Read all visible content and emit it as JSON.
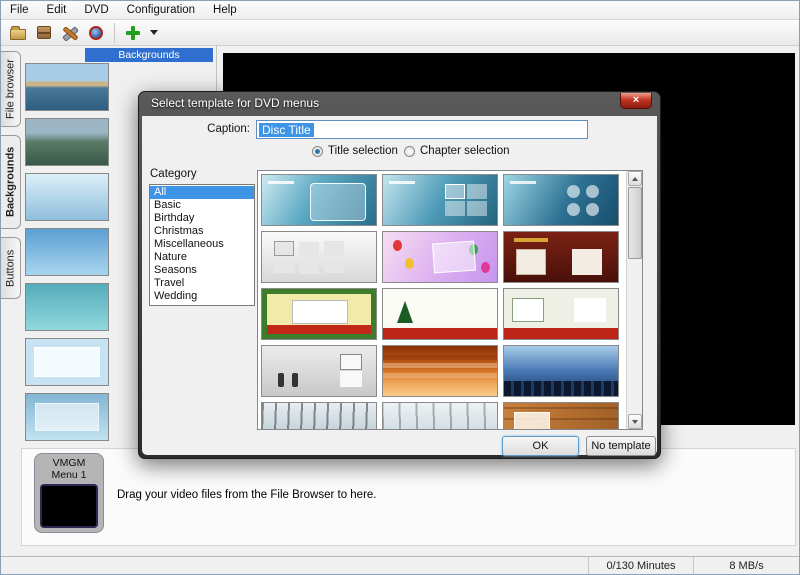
{
  "app": {
    "menu": [
      "File",
      "Edit",
      "DVD",
      "Configuration",
      "Help"
    ],
    "toolbar_icons": [
      "open-folder",
      "project-box",
      "tools",
      "burn-disc",
      "add-menu",
      "add-menu-dropdown"
    ],
    "sidebar_tabs": [
      "File browser",
      "Backgrounds",
      "Buttons"
    ],
    "backgrounds_panel_title": "Backgrounds",
    "backgrounds_thumbs": [
      "coastline-photo",
      "lake-photo",
      "sky-gradient",
      "blue-gradient",
      "teal-gradient",
      "blue-frame",
      "blue-soft"
    ],
    "vmgm_label": "VMGM",
    "menu1_label": "Menu 1",
    "drag_hint": "Drag your video files from the File Browser to here.",
    "status_minutes": "0/130 Minutes",
    "status_speed": "8 MB/s"
  },
  "dialog": {
    "title": "Select template for DVD menus",
    "close_glyph": "×",
    "caption_label": "Caption:",
    "caption_value": "Disc Title",
    "radio_title_label": "Title selection",
    "radio_chapter_label": "Chapter selection",
    "radio_selected": "Title selection",
    "category_label": "Category",
    "categories": [
      "All",
      "Basic",
      "Birthday",
      "Christmas",
      "Miscellaneous",
      "Nature",
      "Seasons",
      "Travel",
      "Wedding"
    ],
    "selected_category": "All",
    "ok_label": "OK",
    "no_template_label": "No template"
  },
  "colors": {
    "selection_blue": "#3f95e5",
    "panel_header_blue": "#2f6fd0",
    "dialog_frame": "#2c2c2c",
    "close_button_red": "#c23524",
    "add_icon_green": "#1fa11f"
  },
  "templates": {
    "rows": 5,
    "cols": 3,
    "items": [
      {
        "name": "blue-glass-panel",
        "colors": [
          "#cdeaf2",
          "#28708e"
        ]
      },
      {
        "name": "blue-glass-grid",
        "colors": [
          "#c4e4ee",
          "#236480"
        ]
      },
      {
        "name": "blue-circles",
        "colors": [
          "#9ed6e4",
          "#184e6e"
        ]
      },
      {
        "name": "gray-frames",
        "colors": [
          "#fafafa",
          "#d8d8d8"
        ]
      },
      {
        "name": "birthday-balloons",
        "colors": [
          "#f6def2",
          "#c695ee"
        ]
      },
      {
        "name": "dark-red-frames",
        "colors": [
          "#7c2214",
          "#49100a"
        ]
      },
      {
        "name": "christmas-border",
        "colors": [
          "#f2eaa8",
          "#c22818"
        ]
      },
      {
        "name": "christmas-trees",
        "colors": [
          "#fbfbf6",
          "#bc2418"
        ]
      },
      {
        "name": "christmas-frames",
        "colors": [
          "#eef0e6",
          "#bc2418"
        ]
      },
      {
        "name": "sketch-figures",
        "colors": [
          "#ececec",
          "#c8c8c8"
        ]
      },
      {
        "name": "sunset-clouds",
        "colors": [
          "#8a3008",
          "#f8cc8a"
        ]
      },
      {
        "name": "city-night",
        "colors": [
          "#a8cce8",
          "#1c3a62"
        ]
      },
      {
        "name": "winter-trees",
        "colors": [
          "#e8eef2",
          "#a8bcc8"
        ]
      },
      {
        "name": "winter-park",
        "colors": [
          "#eef2f4",
          "#bccdd8"
        ]
      },
      {
        "name": "wood-panel",
        "colors": [
          "#c8803c",
          "#a05f26"
        ]
      }
    ]
  }
}
